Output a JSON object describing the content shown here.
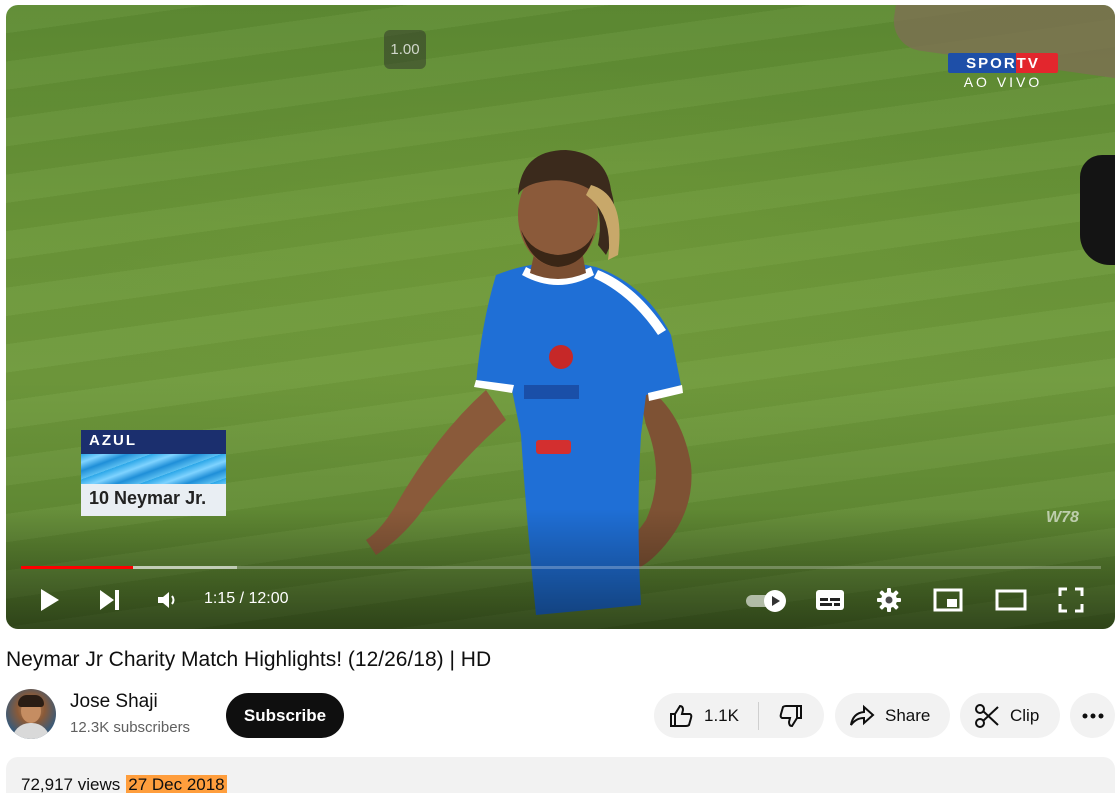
{
  "player": {
    "speed_badge": "1.00",
    "broadcaster_logo": "SPORTV",
    "broadcaster_status": "AO VIVO",
    "lower_third_team": "AZUL",
    "lower_third_player": "10 Neymar Jr.",
    "watermark": "W78",
    "time_display": "1:15 / 12:00",
    "progress_played_fraction": 0.104,
    "progress_buffered_fraction": 0.2,
    "autoplay_on": true,
    "controls": {
      "play": "play-icon",
      "next": "next-icon",
      "volume": "volume-icon",
      "autoplay": "autoplay-toggle-icon",
      "subtitles": "subtitles-icon",
      "settings": "gear-icon",
      "miniplayer": "miniplayer-icon",
      "theater": "theater-mode-icon",
      "fullscreen": "fullscreen-icon"
    }
  },
  "video": {
    "title": "Neymar Jr Charity Match Highlights! (12/26/18) | HD"
  },
  "channel": {
    "name": "Jose Shaji",
    "subscribers": "12.3K subscribers",
    "subscribe_label": "Subscribe"
  },
  "actions": {
    "like_count": "1.1K",
    "share_label": "Share",
    "clip_label": "Clip",
    "more_icon": "more-horizontal-icon"
  },
  "description": {
    "views": "72,917 views",
    "date": "27 Dec 2018"
  },
  "colors": {
    "progress_played": "#ff0000",
    "date_highlight": "#ff9e3d",
    "subscribe_bg": "#0f0f0f"
  }
}
